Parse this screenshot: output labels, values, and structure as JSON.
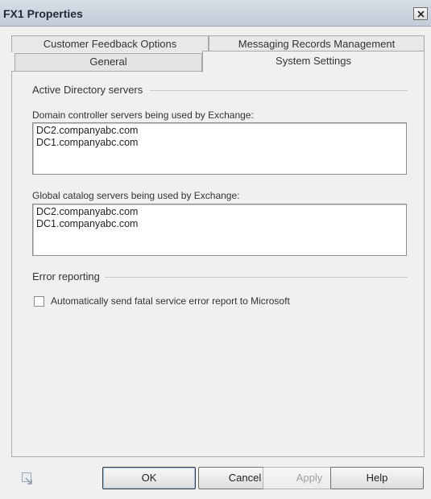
{
  "window": {
    "title": "FX1 Properties",
    "close_label": "x"
  },
  "tabs": {
    "row1": [
      "Customer Feedback Options",
      "Messaging Records Management"
    ],
    "row2": [
      "General",
      "System Settings"
    ],
    "active": "System Settings"
  },
  "active_directory": {
    "section_title": "Active Directory servers",
    "domain_controllers": {
      "label": "Domain controller servers being used by Exchange:",
      "items": [
        "DC2.companyabc.com",
        "DC1.companyabc.com"
      ]
    },
    "global_catalogs": {
      "label": "Global catalog servers being used by Exchange:",
      "items": [
        "DC2.companyabc.com",
        "DC1.companyabc.com"
      ]
    }
  },
  "error_reporting": {
    "section_title": "Error reporting",
    "checkbox_label": "Automatically send fatal service error report to Microsoft",
    "checked": false
  },
  "buttons": {
    "ok": "OK",
    "cancel": "Cancel",
    "apply": "Apply",
    "help": "Help"
  },
  "colors": {
    "titlebar": "#c3ccd8",
    "dialog_bg": "#f0f0f0",
    "listbox_bg": "#ffffff"
  }
}
